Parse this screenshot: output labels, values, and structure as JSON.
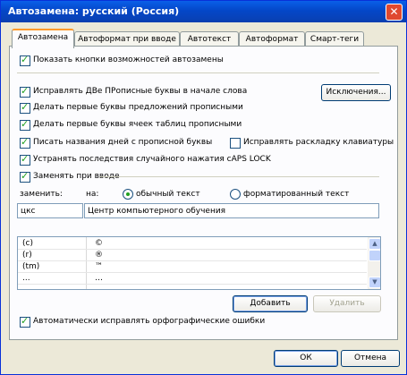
{
  "window": {
    "title": "Автозамена: русский (Россия)",
    "close": "✕"
  },
  "tabs": [
    {
      "label": "Автозамена"
    },
    {
      "label": "Автоформат при вводе"
    },
    {
      "label": "Автотекст"
    },
    {
      "label": "Автоформат"
    },
    {
      "label": "Смарт-теги"
    }
  ],
  "options": {
    "show_buttons": "Показать кнопки возможностей автозамены",
    "fix_two_caps": "Исправлять ДВе ПРописные буквы в начале слова",
    "capitalize_sentences": "Делать первые буквы предложений прописными",
    "capitalize_table_cells": "Делать первые буквы ячеек таблиц прописными",
    "capitalize_days": "Писать названия дней с прописной буквы",
    "fix_keyboard_layout": "Исправлять раскладку клавиатуры",
    "fix_caps_lock": "Устранять последствия случайного нажатия cAPS LOCK",
    "replace_as_type": "Заменять при вводе",
    "auto_spell": "Автоматически исправлять орфографические ошибки"
  },
  "exceptions_button": "Исключения...",
  "replace": {
    "replace_label": "заменить:",
    "with_label": "на:",
    "plain_text": "обычный текст",
    "formatted_text": "форматированный текст",
    "replace_value": "цкс",
    "with_value": "Центр компьютерного обучения"
  },
  "list": [
    {
      "from": "(c)",
      "to": "©"
    },
    {
      "from": "(r)",
      "to": "®"
    },
    {
      "from": "(tm)",
      "to": "™"
    },
    {
      "from": "...",
      "to": "…"
    }
  ],
  "buttons": {
    "add": "Добавить",
    "delete": "Удалить",
    "ok": "ОК",
    "cancel": "Отмена"
  }
}
